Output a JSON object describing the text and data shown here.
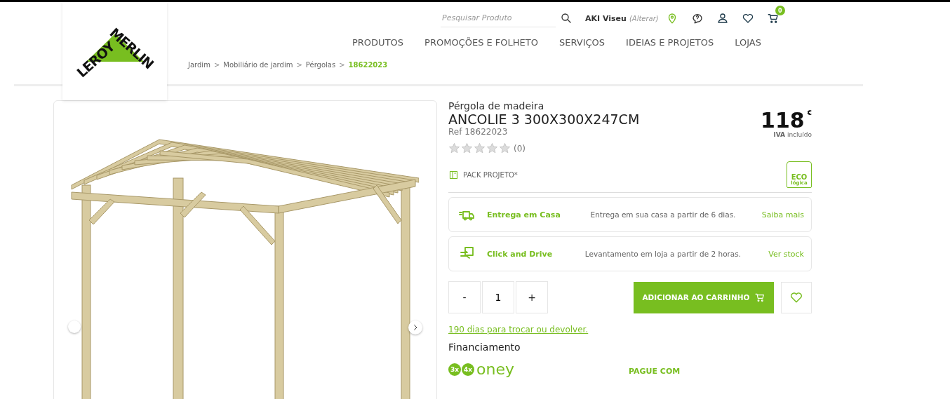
{
  "logo": {
    "word_1": "LEROY",
    "word_2": "MERLIN"
  },
  "search": {
    "placeholder": "Pesquisar Produto"
  },
  "store": {
    "name": "AKI Viseu",
    "action": "(Alterar)"
  },
  "cart": {
    "count": "0"
  },
  "nav": [
    "PRODUTOS",
    "PROMOÇÕES E FOLHETO",
    "SERVIÇOS",
    "IDEIAS E PROJETOS",
    "LOJAS"
  ],
  "breadcrumb": [
    {
      "label": "Jardim",
      "selected": false
    },
    {
      "label": "Mobiliário de jardim",
      "selected": false
    },
    {
      "label": "Pérgolas",
      "selected": false
    },
    {
      "label": "18622023",
      "selected": true
    }
  ],
  "breadcrumb_separator": ">",
  "product": {
    "category": "Pérgola de madeira",
    "title": "ANCOLIE 3 300X300X247CM",
    "ref": "Ref 18622023",
    "stars": 0,
    "reviews": "(0)",
    "pack": "PACK PROJETO*",
    "price": "118",
    "currency": "€",
    "tax": "**IVA** incluído",
    "eco_1": "ECO",
    "eco_2": "lógica"
  },
  "delivery": [
    {
      "kind": "truck",
      "title": "Entrega em Casa",
      "text": "Entrega em sua casa a partir de 6 dias.",
      "link": "Saiba mais"
    },
    {
      "kind": "hand",
      "title": "Click and Drive",
      "text": "Levantamento em loja a partir de 2 horas.",
      "link": "Ver stock"
    }
  ],
  "quantity": {
    "minus": "-",
    "value": "1",
    "plus": "+"
  },
  "add_to_cart": "ADICIONAR AO CARRINHO",
  "returns_link": "190 dias para trocar ou devolver.",
  "financing": {
    "title": "Financiamento",
    "brand": "oney",
    "badge_1": "3x",
    "badge_2": "4x",
    "pay": "PAGUE COM"
  }
}
